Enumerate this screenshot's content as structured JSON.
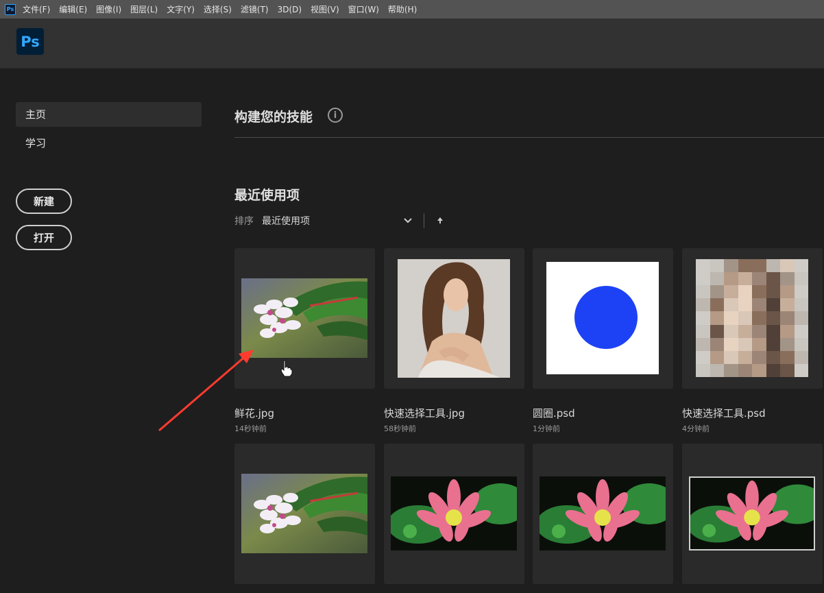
{
  "menubar": {
    "app_icon_text": "Ps",
    "items": [
      "文件(F)",
      "编辑(E)",
      "图像(I)",
      "图层(L)",
      "文字(Y)",
      "选择(S)",
      "滤镜(T)",
      "3D(D)",
      "视图(V)",
      "窗口(W)",
      "帮助(H)"
    ]
  },
  "header": {
    "logo_text": "Ps"
  },
  "sidebar": {
    "items": [
      {
        "label": "主页",
        "active": true
      },
      {
        "label": "学习",
        "active": false
      }
    ],
    "new_button": "新建",
    "open_button": "打开"
  },
  "main": {
    "skills_title": "构建您的技能",
    "info_glyph": "i",
    "recent_title": "最近使用项",
    "sort_label": "排序",
    "sort_value": "最近使用项",
    "icons": {
      "info": "info-icon",
      "sort_dropdown": "chevron-down-icon",
      "sort_direction": "arrow-up-icon"
    }
  },
  "recent_files": [
    {
      "name": "鲜花.jpg",
      "time": "14秒钟前",
      "thumb": "flower"
    },
    {
      "name": "快速选择工具.jpg",
      "time": "58秒钟前",
      "thumb": "portrait"
    },
    {
      "name": "圆圈.psd",
      "time": "1分钟前",
      "thumb": "circle"
    },
    {
      "name": "快速选择工具.psd",
      "time": "4分钟前",
      "thumb": "pixelated"
    },
    {
      "thumb": "flower"
    },
    {
      "thumb": "lotus"
    },
    {
      "thumb": "lotus"
    },
    {
      "thumb": "lotus-selected"
    }
  ],
  "colors": {
    "menubar_bg": "#535353",
    "header_bg": "#323232",
    "app_bg": "#1e1e1e",
    "card_bg": "#2a2a2a",
    "ps_blue": "#31a8ff",
    "circle_blue": "#1d42f5",
    "annotation_red": "#ff3b30"
  }
}
